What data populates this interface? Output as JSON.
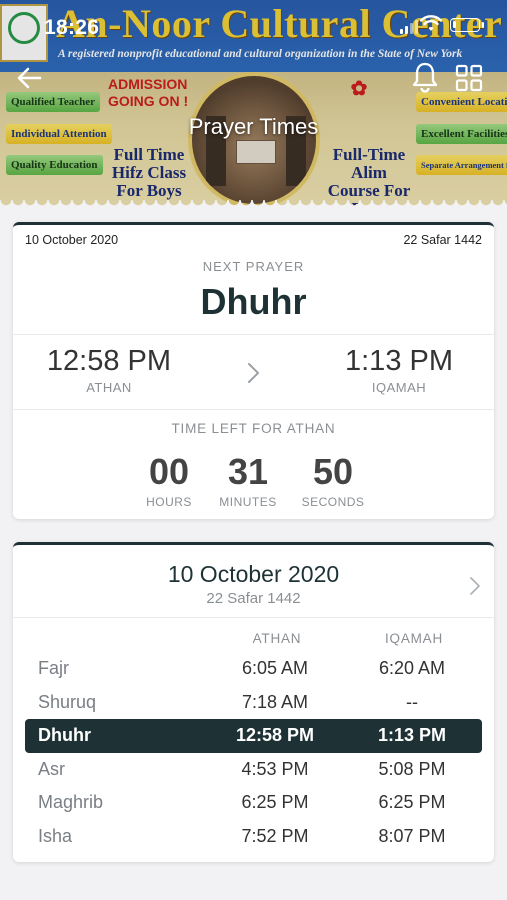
{
  "status_bar": {
    "time": "18:26"
  },
  "banner": {
    "org_name": "An-Noor Cultural Center",
    "org_subtitle": "A registered nonprofit educational and cultural organization in the State of New York",
    "left_features": [
      "Qualified Teacher",
      "Individual Attention",
      "Quality Education"
    ],
    "right_features": [
      "Convenient Location",
      "Excellent Facilities",
      "Separate Arrangement for Sisters"
    ],
    "admission": "ADMISSION GOING ON !",
    "course_left": "Full Time Hifz Class For Boys",
    "course_right": "Full-Time Alim Course For Boys"
  },
  "nav": {
    "title": "Prayer Times"
  },
  "next_prayer_card": {
    "gregorian_date": "10 October 2020",
    "hijri_date": "22 Safar 1442",
    "next_prayer_label": "NEXT PRAYER",
    "next_prayer_name": "Dhuhr",
    "athan_time": "12:58 PM",
    "athan_label": "ATHAN",
    "iqamah_time": "1:13 PM",
    "iqamah_label": "IQAMAH",
    "time_left_label": "TIME LEFT FOR ATHAN",
    "countdown": {
      "hours": "00",
      "hours_label": "HOURS",
      "minutes": "31",
      "minutes_label": "MINUTES",
      "seconds": "50",
      "seconds_label": "SECONDS"
    }
  },
  "day_schedule": {
    "date": "10 October 2020",
    "hijri": "22 Safar 1442",
    "athan_header": "ATHAN",
    "iqamah_header": "IQAMAH",
    "prayers": [
      {
        "name": "Fajr",
        "athan": "6:05 AM",
        "iqamah": "6:20 AM"
      },
      {
        "name": "Shuruq",
        "athan": "7:18 AM",
        "iqamah": "--"
      },
      {
        "name": "Dhuhr",
        "athan": "12:58 PM",
        "iqamah": "1:13 PM",
        "active": true
      },
      {
        "name": "Asr",
        "athan": "4:53 PM",
        "iqamah": "5:08 PM"
      },
      {
        "name": "Maghrib",
        "athan": "6:25 PM",
        "iqamah": "6:25 PM"
      },
      {
        "name": "Isha",
        "athan": "7:52 PM",
        "iqamah": "8:07 PM"
      }
    ]
  },
  "colors": {
    "primary_dark": "#1e3236",
    "muted": "#8a8f94",
    "background": "#f2f2f4"
  }
}
